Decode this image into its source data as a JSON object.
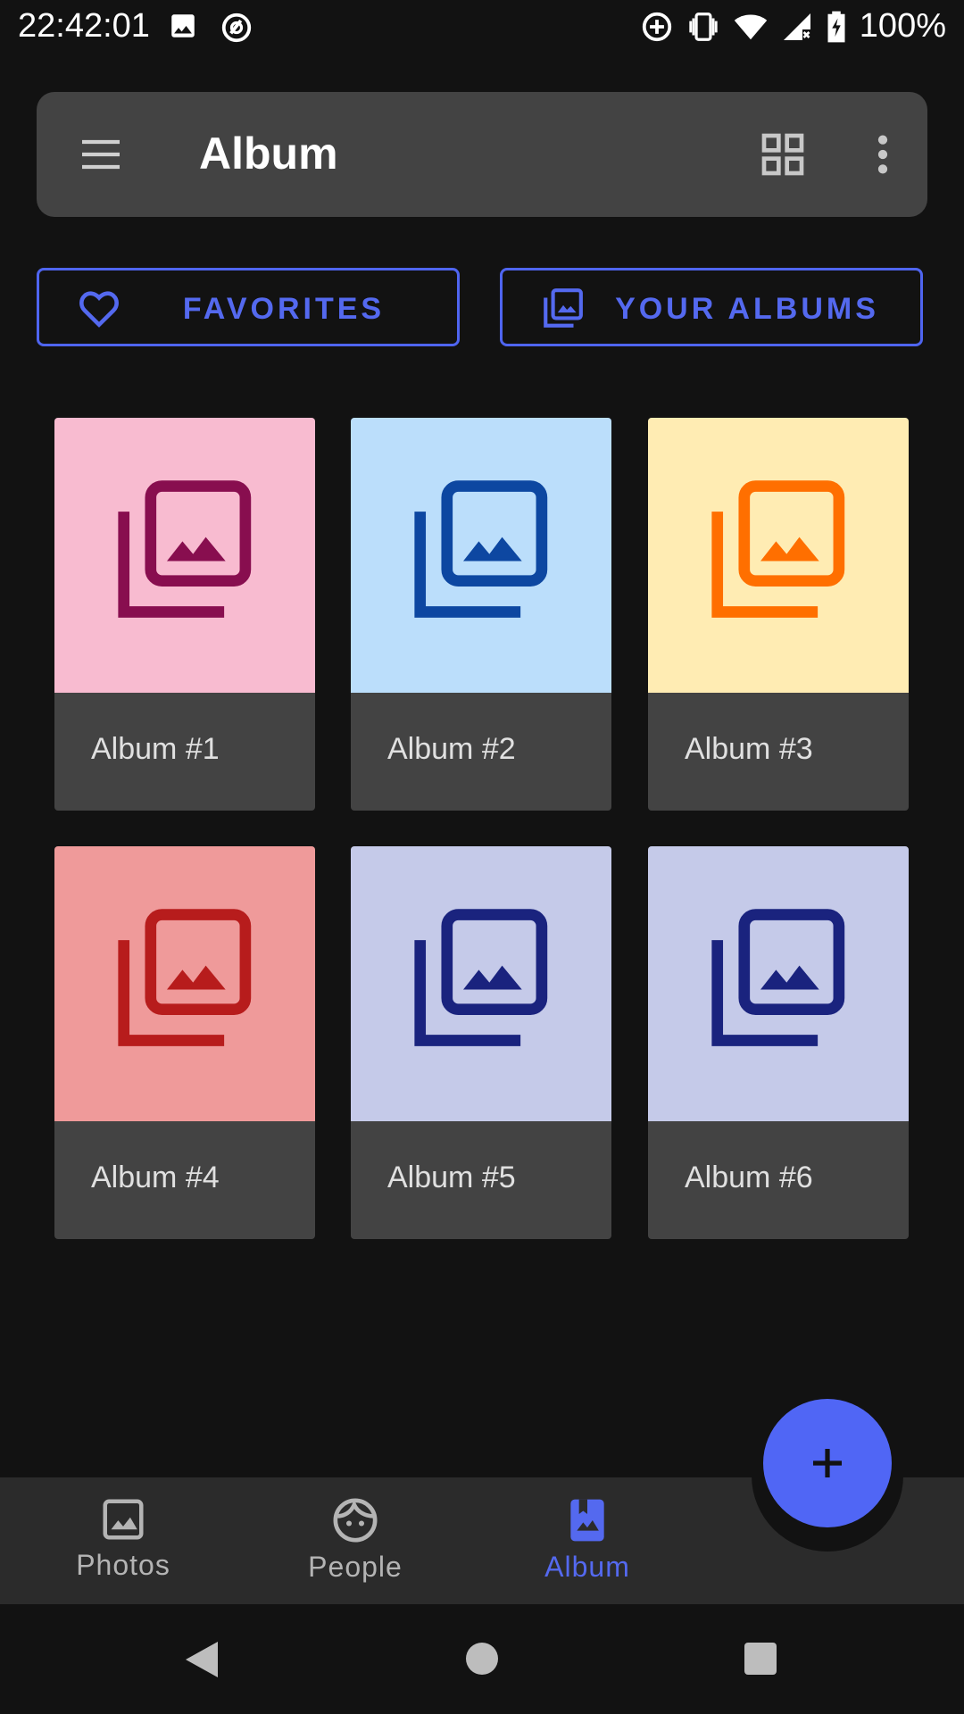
{
  "status_bar": {
    "time": "22:42:01",
    "battery": "100%"
  },
  "app_bar": {
    "title": "Album"
  },
  "chips": {
    "favorites": "FAVORITES",
    "your_albums": "YOUR ALBUMS"
  },
  "albums": [
    {
      "label": "Album #1",
      "bg": "#f8bbd0",
      "fg": "#880e4f"
    },
    {
      "label": "Album #2",
      "bg": "#bbdefb",
      "fg": "#0d47a1"
    },
    {
      "label": "Album #3",
      "bg": "#ffecb3",
      "fg": "#ff6f00"
    },
    {
      "label": "Album #4",
      "bg": "#ef9a9a",
      "fg": "#b71c1c"
    },
    {
      "label": "Album #5",
      "bg": "#c5cae9",
      "fg": "#1a237e"
    },
    {
      "label": "Album #6",
      "bg": "#c5cae9",
      "fg": "#1a237e"
    }
  ],
  "bottom_nav": {
    "photos": "Photos",
    "people": "People",
    "album": "Album"
  },
  "colors": {
    "accent": "#5066f5",
    "surface": "#434343",
    "background": "#121212"
  },
  "icons": [
    "menu-icon",
    "grid-view-icon",
    "more-vert-icon",
    "heart-icon",
    "photo-library-icon",
    "add-icon",
    "image-icon",
    "face-icon",
    "photo-album-icon",
    "back-icon",
    "home-icon",
    "recents-icon"
  ]
}
